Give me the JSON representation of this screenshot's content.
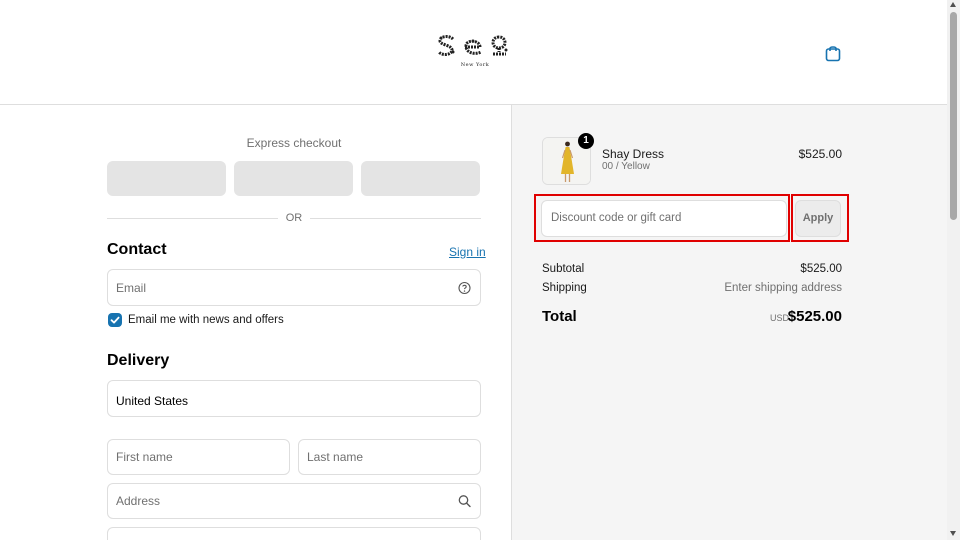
{
  "brand": {
    "logo_subtext": "New York"
  },
  "express_checkout": {
    "label": "Express checkout",
    "divider": "OR"
  },
  "contact": {
    "heading": "Contact",
    "signin_label": "Sign in",
    "email_placeholder": "Email",
    "newsletter_label": "Email me with news and offers",
    "newsletter_checked": true
  },
  "delivery": {
    "heading": "Delivery",
    "country_value": "United States",
    "first_name_placeholder": "First name",
    "last_name_placeholder": "Last name",
    "address_placeholder": "Address"
  },
  "order": {
    "item": {
      "name": "Shay Dress",
      "variant": "00 / Yellow",
      "price": "$525.00",
      "quantity": "1"
    },
    "discount_placeholder": "Discount code or gift card",
    "apply_label": "Apply",
    "subtotal_label": "Subtotal",
    "subtotal_value": "$525.00",
    "shipping_label": "Shipping",
    "shipping_value": "Enter shipping address",
    "total_label": "Total",
    "total_currency": "USD",
    "total_value": "$525.00"
  },
  "colors": {
    "accent": "#1773b0",
    "highlight": "#e00000",
    "summary_bg": "#f5f5f5"
  },
  "icons": [
    "shopping-bag-icon",
    "help-circle-icon",
    "check-icon",
    "search-icon"
  ]
}
